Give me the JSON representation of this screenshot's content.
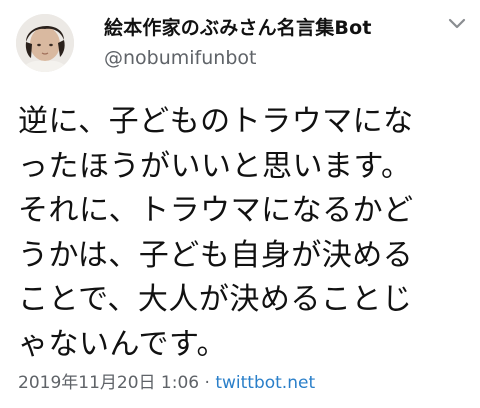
{
  "tweet": {
    "author_name": "絵本作家のぶみさん名言集Bot",
    "author_handle": "@nobumifunbot",
    "body_lines": [
      "逆に、子どものトラウマにな",
      "ったほうがいいと思います。",
      "それに、トラウマになるかど",
      "うかは、子ども自身が決める",
      "ことで、大人が決めることじ",
      "ゃないんです。"
    ],
    "timestamp": "2019年11月20日 1:06",
    "separator": " · ",
    "source": "twittbot.net"
  },
  "icons": {
    "avatar": "profile-photo",
    "menu": "chevron-down-icon"
  },
  "colors": {
    "text": "#111111",
    "secondary": "#5f6368",
    "link": "#2a7fc9",
    "background": "#ffffff"
  }
}
